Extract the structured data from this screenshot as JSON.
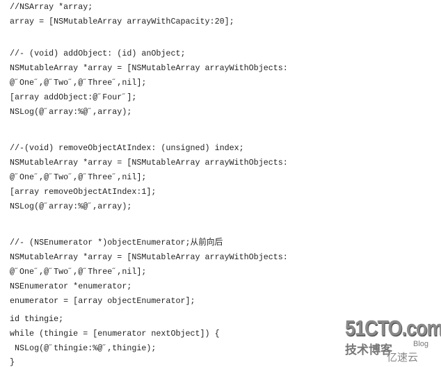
{
  "code_lines": [
    "//NSArray *array;",
    "array = [NSMutableArray arrayWithCapacity:20];",
    "//- (void) addObject: (id) anObject;",
    "NSMutableArray *array = [NSMutableArray arrayWithObjects:",
    "@˝One˝,@˝Two˝,@˝Three˝,nil];",
    "[array addObject:@˝Four˝];",
    "NSLog(@˝array:%@˝,array);",
    "//-(void) removeObjectAtIndex: (unsigned) index;",
    "NSMutableArray *array = [NSMutableArray arrayWithObjects:",
    "@˝One˝,@˝Two˝,@˝Three˝,nil];",
    "[array removeObjectAtIndex:1];",
    "NSLog(@˝array:%@˝,array);",
    "//- (NSEnumerator *)objectEnumerator;从前向后",
    "NSMutableArray *array = [NSMutableArray arrayWithObjects:",
    "@˝One˝,@˝Two˝,@˝Three˝,nil];",
    "NSEnumerator *enumerator;",
    "enumerator = [array objectEnumerator];",
    "id thingie;",
    "while (thingie = [enumerator nextObject]) {",
    " NSLog(@˝thingie:%@˝,thingie);",
    "}"
  ],
  "watermark": {
    "site": "51CTO.com",
    "subtitle": "技术博客",
    "blog": "Blog",
    "brand": "亿速云"
  }
}
